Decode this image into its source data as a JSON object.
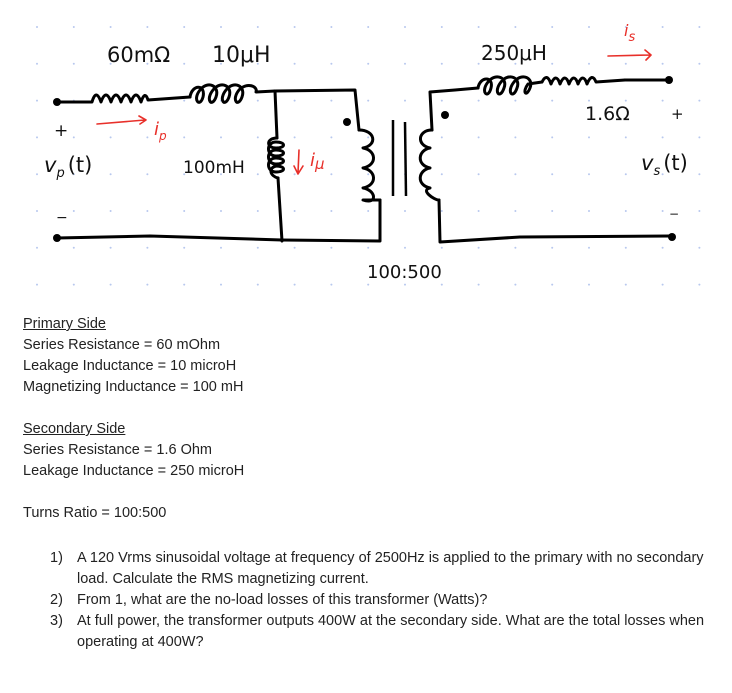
{
  "diagram": {
    "primary": {
      "series_resistance_label": "60mΩ",
      "leakage_inductance_label": "10μH",
      "magnetizing_inductance_label": "100mH",
      "voltage_label": "v",
      "voltage_subscript": "p",
      "voltage_suffix": "(t)",
      "current_label": "i",
      "current_subscript": "p",
      "magnetizing_current_label": "i",
      "magnetizing_current_subscript": "μ",
      "plus_sign": "+",
      "minus_sign": "−"
    },
    "secondary": {
      "leakage_inductance_label": "250μH",
      "series_resistance_label": "1.6Ω",
      "voltage_label": "v",
      "voltage_subscript": "s",
      "voltage_suffix": "(t)",
      "current_label": "i",
      "current_subscript": "s",
      "plus_sign": "+",
      "minus_sign": "−"
    },
    "turns_ratio_label": "100:500",
    "colors": {
      "ink": "#000000",
      "annotation": "#e8302a",
      "grid_dot": "#b8c8ee"
    }
  },
  "parameters": {
    "primary_heading": "Primary Side",
    "primary_lines": [
      "Series Resistance = 60 mOhm",
      "Leakage Inductance = 10 microH",
      "Magnetizing Inductance = 100 mH"
    ],
    "secondary_heading": "Secondary Side",
    "secondary_lines": [
      "Series Resistance = 1.6 Ohm",
      "Leakage Inductance = 250 microH"
    ],
    "turns_ratio": "Turns Ratio = 100:500"
  },
  "questions": [
    {
      "number": "1)",
      "text": "A 120 Vrms sinusoidal voltage at frequency of 2500Hz is applied to the primary with no secondary load. Calculate the RMS magnetizing current."
    },
    {
      "number": "2)",
      "text": "From 1, what are the no-load losses of this transformer (Watts)?"
    },
    {
      "number": "3)",
      "text": "At full power, the transformer outputs 400W at the secondary side. What are the total losses when operating at 400W?"
    }
  ]
}
